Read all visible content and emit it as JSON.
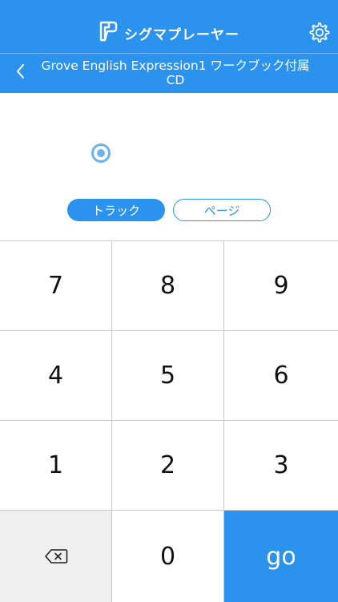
{
  "app_bar": {
    "brand_title": "シグマプレーヤー",
    "logo_icon": "sigma-logo-icon",
    "settings_icon": "gear-icon"
  },
  "sub_bar": {
    "back_icon": "chevron-left-icon",
    "title": "Grove English Expression1 ワークブック付属CD"
  },
  "display": {
    "indicator_icon": "target-icon"
  },
  "mode": {
    "track_label": "トラック",
    "page_label": "ページ",
    "selected": "トラック"
  },
  "keypad": {
    "k7": "7",
    "k8": "8",
    "k9": "9",
    "k4": "4",
    "k5": "5",
    "k6": "6",
    "k1": "1",
    "k2": "2",
    "k3": "3",
    "k0": "0",
    "go": "go",
    "delete_icon": "backspace-icon"
  },
  "colors": {
    "accent": "#2b93ee",
    "divider": "#c9c9c9",
    "delete_key_bg": "#efefef"
  }
}
